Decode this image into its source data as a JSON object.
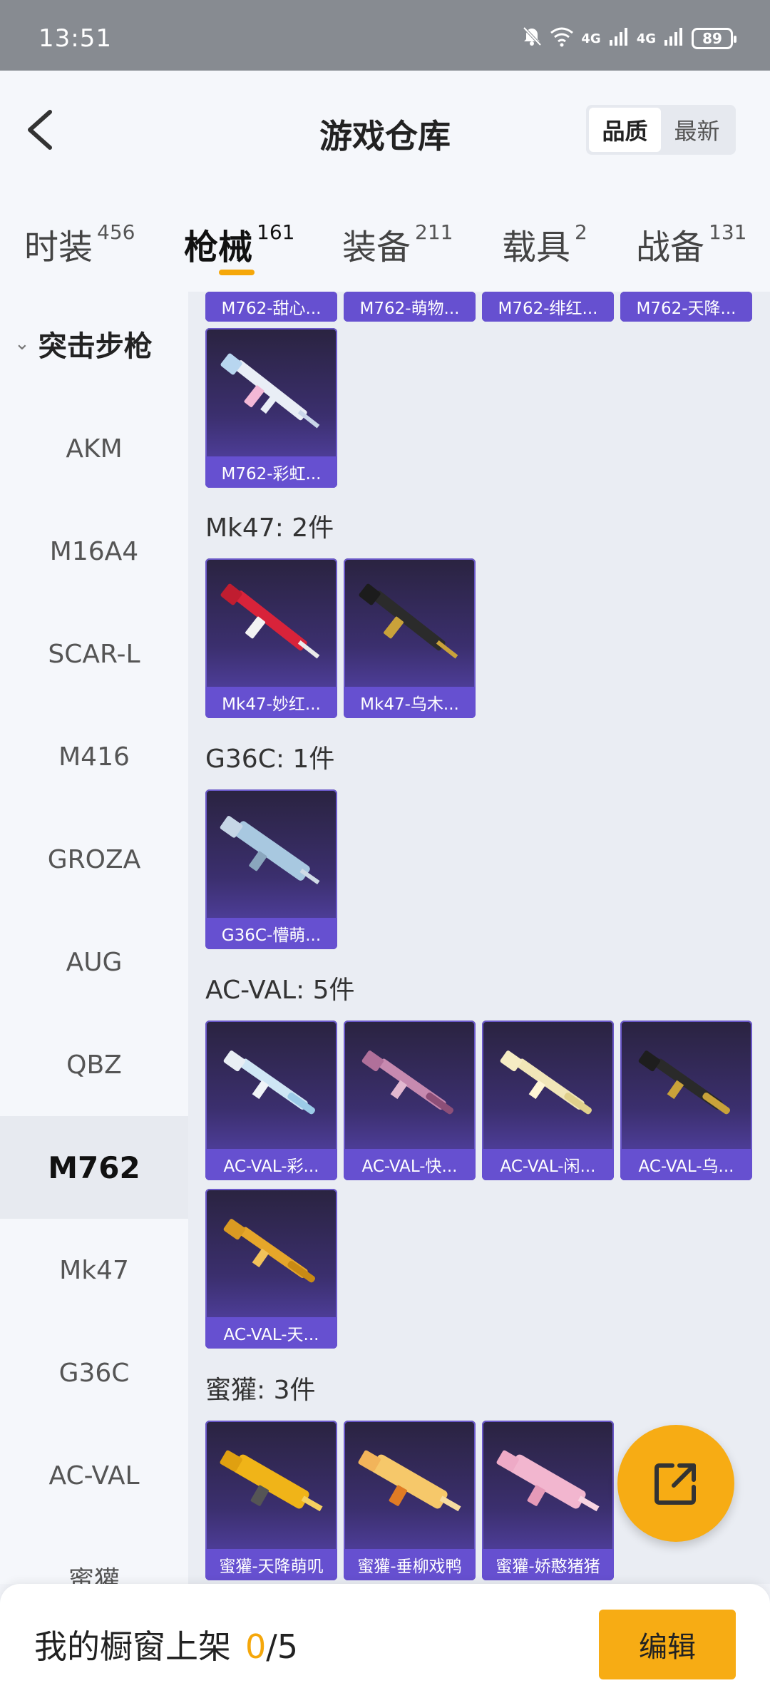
{
  "status_bar": {
    "time": "13:51",
    "battery": "89",
    "signal1": "4G",
    "signal2": "4G"
  },
  "header": {
    "title": "游戏仓库",
    "sort_options": [
      "品质",
      "最新"
    ]
  },
  "tabs": [
    {
      "label": "时装",
      "count": "456"
    },
    {
      "label": "枪械",
      "count": "161"
    },
    {
      "label": "装备",
      "count": "211"
    },
    {
      "label": "载具",
      "count": "2"
    },
    {
      "label": "战备",
      "count": "131"
    }
  ],
  "sidebar": {
    "category": "突击步枪",
    "items": [
      "AKM",
      "M16A4",
      "SCAR-L",
      "M416",
      "GROZA",
      "AUG",
      "QBZ",
      "M762",
      "Mk47",
      "G36C",
      "AC-VAL",
      "蜜獾"
    ],
    "selected": "M762"
  },
  "content": {
    "partial_row": [
      "M762-甜心...",
      "M762-萌物...",
      "M762-绯红...",
      "M762-天降..."
    ],
    "m762_tail": [
      "M762-彩虹..."
    ],
    "groups": [
      {
        "title": "Mk47: 2件",
        "items": [
          "Mk47-妙红...",
          "Mk47-乌木..."
        ]
      },
      {
        "title": "G36C: 1件",
        "items": [
          "G36C-懵萌..."
        ]
      },
      {
        "title": "AC-VAL: 5件",
        "items": [
          "AC-VAL-彩...",
          "AC-VAL-快...",
          "AC-VAL-闲...",
          "AC-VAL-乌...",
          "AC-VAL-天..."
        ]
      },
      {
        "title": "蜜獾: 3件",
        "items": [
          "蜜獾-天降萌叽",
          "蜜獾-垂柳戏鸭",
          "蜜獾-娇憨猪猪"
        ]
      }
    ]
  },
  "bottom_bar": {
    "label": "我的橱窗上架",
    "current": "0",
    "total": "/5",
    "edit_label": "编辑"
  },
  "colors": {
    "accent": "#f7ac14",
    "card_name_bg": "#6650d0"
  }
}
